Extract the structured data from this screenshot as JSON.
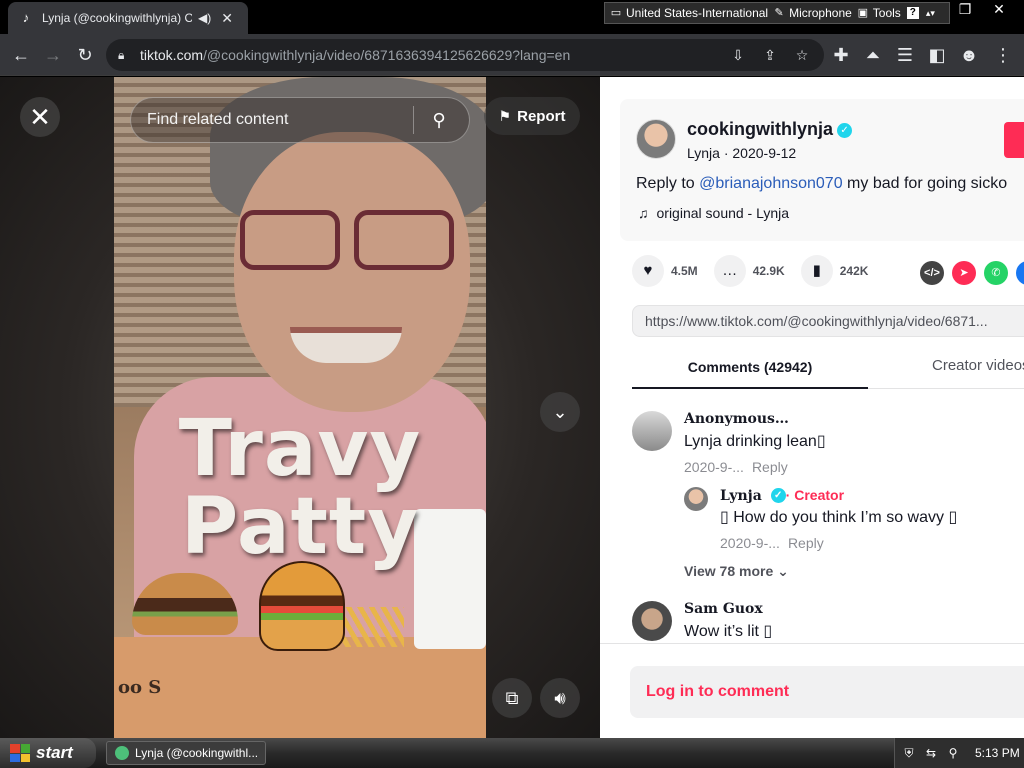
{
  "browser": {
    "tab_title": "Lynja (@cookingwithlynja) Offi",
    "url_host": "tiktok.com",
    "url_path": "/@cookingwithlynja/video/6871636394125626629?lang=en"
  },
  "langbar": {
    "language": "United States-International",
    "microphone": "Microphone",
    "tools": "Tools",
    "help": "?"
  },
  "video": {
    "search_placeholder": "Find related content",
    "report_label": "Report",
    "overlay_line1": "Travy",
    "overlay_line2": "Patty",
    "watermark": "oo S"
  },
  "post": {
    "author_handle": "cookingwithlynja",
    "author_sub": "Lynja · 2020-9-12",
    "caption_prefix": "Reply to ",
    "caption_mention": "@brianajohnson070",
    "caption_rest": " my bad for going sicko",
    "sound": "original sound - Lynja",
    "likes": "4.5M",
    "comments_count": "42.9K",
    "saves": "242K",
    "link": "https://www.tiktok.com/@cookingwithlynja/video/6871..."
  },
  "tabs": {
    "comments": "Comments (42942)",
    "creator_videos": "Creator videos"
  },
  "comments": [
    {
      "name": "Anonymous…",
      "text": "Lynja drinking lean▯",
      "date": "2020-9-...",
      "reply": "Reply"
    },
    {
      "name": "Lynja",
      "tag": "· Creator",
      "text": "▯ How do you think I’m so wavy ▯",
      "date": "2020-9-...",
      "reply": "Reply"
    },
    {
      "name": "Sam Guox",
      "text": "Wow it’s lit ▯"
    }
  ],
  "view_more": "View 78 more",
  "login_prompt": "Log in to comment",
  "taskbar": {
    "start": "start",
    "task_label": "Lynja (@cookingwithl...",
    "clock": "5:13 PM"
  },
  "colors": {
    "brand_red": "#fe2c55",
    "mention_blue": "#2b5db9",
    "verified_cyan": "#20d5ec"
  }
}
